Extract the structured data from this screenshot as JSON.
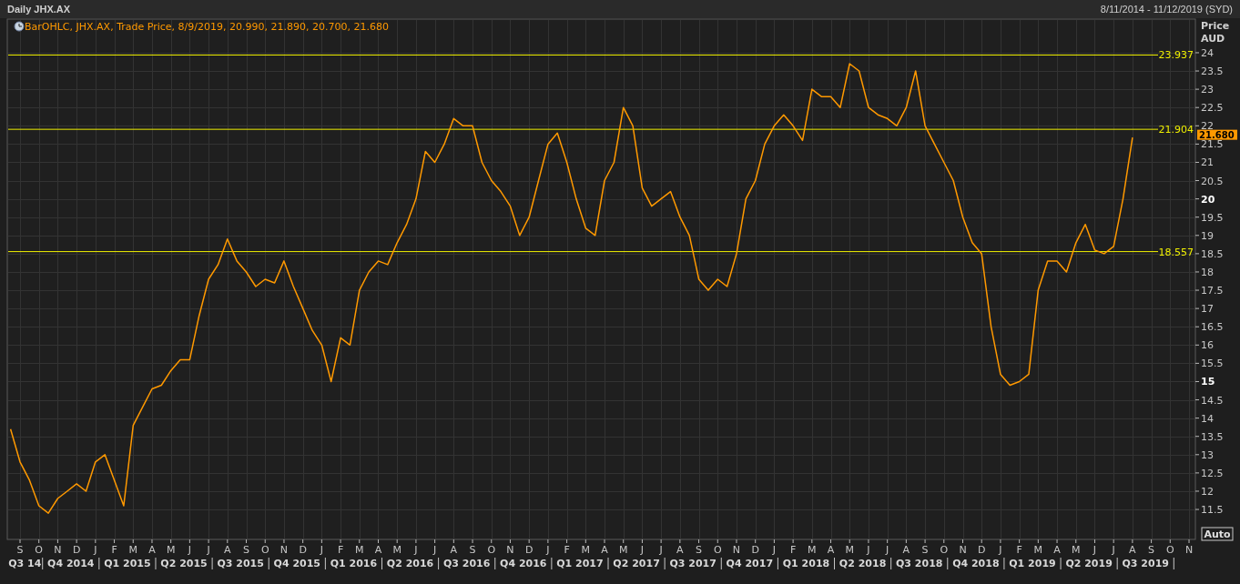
{
  "header": {
    "title": "Daily JHX.AX",
    "date_range": "8/11/2014 - 11/12/2019 (SYD)"
  },
  "legend": {
    "text": "BarOHLC, JHX.AX, Trade Price, 8/9/2019, 20.990, 21.890, 20.700, 21.680"
  },
  "axis_header": [
    "Price",
    "AUD"
  ],
  "auto_button": "Auto",
  "quarters": [
    "Q3 14",
    "Q4 2014",
    "Q1 2015",
    "Q2 2015",
    "Q3 2015",
    "Q4 2015",
    "Q1 2016",
    "Q2 2016",
    "Q3 2016",
    "Q4 2016",
    "Q1 2017",
    "Q2 2017",
    "Q3 2017",
    "Q4 2017",
    "Q1 2018",
    "Q2 2018",
    "Q3 2018",
    "Q4 2018",
    "Q1 2019",
    "Q2 2019",
    "Q3 2019"
  ],
  "chart": {
    "chart_data": {
      "type": "line",
      "categories": [
        null,
        null,
        "S",
        null,
        "O",
        null,
        "N",
        null,
        "D",
        null,
        "J",
        null,
        "F",
        null,
        "M",
        null,
        "A",
        null,
        "M",
        null,
        "J",
        null,
        "J",
        null,
        "A",
        null,
        "S",
        null,
        "O",
        null,
        "N",
        null,
        "D",
        null,
        "J",
        null,
        "F",
        null,
        "M",
        null,
        "A",
        null,
        "M",
        null,
        "J",
        null,
        "J",
        null,
        "A",
        null,
        "S",
        null,
        "O",
        null,
        "N",
        null,
        "D",
        null,
        "J",
        null,
        "F",
        null,
        "M",
        null,
        "A",
        null,
        "M",
        null,
        "J",
        null,
        "J",
        null,
        "A",
        null,
        "S",
        null,
        "O",
        null,
        "N",
        null,
        "D",
        null,
        "J",
        null,
        "F",
        null,
        "M",
        null,
        "A",
        null,
        "M",
        null,
        "J",
        null,
        "J",
        null,
        "A",
        null,
        "S",
        null,
        "O",
        null,
        "N",
        null,
        "D",
        null,
        "J",
        null,
        "F",
        null,
        "M",
        null,
        "A",
        null,
        "M",
        null,
        "J",
        null,
        "J",
        null,
        "A",
        null,
        "S",
        null,
        "O",
        null,
        "N",
        null
      ],
      "series": [
        {
          "color": "#ff9900",
          "values": [
            null,
            13.7,
            12.8,
            12.3,
            11.6,
            11.4,
            11.8,
            12.0,
            12.2,
            12.0,
            12.8,
            13.0,
            12.3,
            11.6,
            13.8,
            14.3,
            14.8,
            14.9,
            15.3,
            15.6,
            15.6,
            16.8,
            17.8,
            18.2,
            18.9,
            18.3,
            18.0,
            17.6,
            17.8,
            17.7,
            18.3,
            17.6,
            17.0,
            16.4,
            16.0,
            15.0,
            16.2,
            16.0,
            17.5,
            18.0,
            18.3,
            18.2,
            18.8,
            19.3,
            20.0,
            21.3,
            21.0,
            21.5,
            22.2,
            22.0,
            22.0,
            21.0,
            20.5,
            20.2,
            19.8,
            19.0,
            19.5,
            20.5,
            21.5,
            21.8,
            21.0,
            20.0,
            19.2,
            19.0,
            20.5,
            21.0,
            22.5,
            22.0,
            20.3,
            19.8,
            20.0,
            20.2,
            19.5,
            19.0,
            17.8,
            17.5,
            17.8,
            17.6,
            18.5,
            20.0,
            20.5,
            21.5,
            22.0,
            22.3,
            22.0,
            21.6,
            23.0,
            22.8,
            22.8,
            22.5,
            23.7,
            23.5,
            22.5,
            22.3,
            22.2,
            22.0,
            22.5,
            23.5,
            22.0,
            21.5,
            21.0,
            20.5,
            19.5,
            18.8,
            18.5,
            16.5,
            15.2,
            14.9,
            15.0,
            15.2,
            17.5,
            18.3,
            18.3,
            18.0,
            18.8,
            19.3,
            18.6,
            18.5,
            18.7,
            20.0,
            21.68,
            null,
            null,
            null,
            null,
            null,
            null,
            null
          ]
        }
      ],
      "ylim": [
        10.68,
        24.92
      ],
      "grid": true,
      "yticks": [
        {
          "value": 11.5,
          "label": "11.5"
        },
        {
          "value": 12,
          "label": "12"
        },
        {
          "value": 12.5,
          "label": "12.5"
        },
        {
          "value": 13,
          "label": "13"
        },
        {
          "value": 13.5,
          "label": "13.5"
        },
        {
          "value": 14,
          "label": "14"
        },
        {
          "value": 14.5,
          "label": "14.5"
        },
        {
          "value": 15,
          "label": "15"
        },
        {
          "value": 15.5,
          "label": "15.5"
        },
        {
          "value": 16,
          "label": "16"
        },
        {
          "value": 16.5,
          "label": "16.5"
        },
        {
          "value": 17,
          "label": "17"
        },
        {
          "value": 17.5,
          "label": "17.5"
        },
        {
          "value": 18,
          "label": "18"
        },
        {
          "value": 18.5,
          "label": "18.5"
        },
        {
          "value": 19,
          "label": "19"
        },
        {
          "value": 19.5,
          "label": "19.5"
        },
        {
          "value": 20,
          "label": "20"
        },
        {
          "value": 20.5,
          "label": "20.5"
        },
        {
          "value": 21,
          "label": "21"
        },
        {
          "value": 21.5,
          "label": "21.5"
        },
        {
          "value": 22,
          "label": "22"
        },
        {
          "value": 22.5,
          "label": "22.5"
        },
        {
          "value": 23,
          "label": "23"
        },
        {
          "value": 23.5,
          "label": "23.5"
        },
        {
          "value": 24,
          "label": "24"
        }
      ],
      "ref_lines": [
        {
          "axis": "y",
          "value": 23.937,
          "label": "23.937",
          "color": "#f0f000"
        },
        {
          "axis": "y",
          "value": 21.904,
          "label": "21.904",
          "color": "#f0f000"
        },
        {
          "axis": "y",
          "value": 18.557,
          "label": "18.557",
          "color": "#f0f000"
        }
      ],
      "annotations": [
        "21.680"
      ]
    }
  }
}
